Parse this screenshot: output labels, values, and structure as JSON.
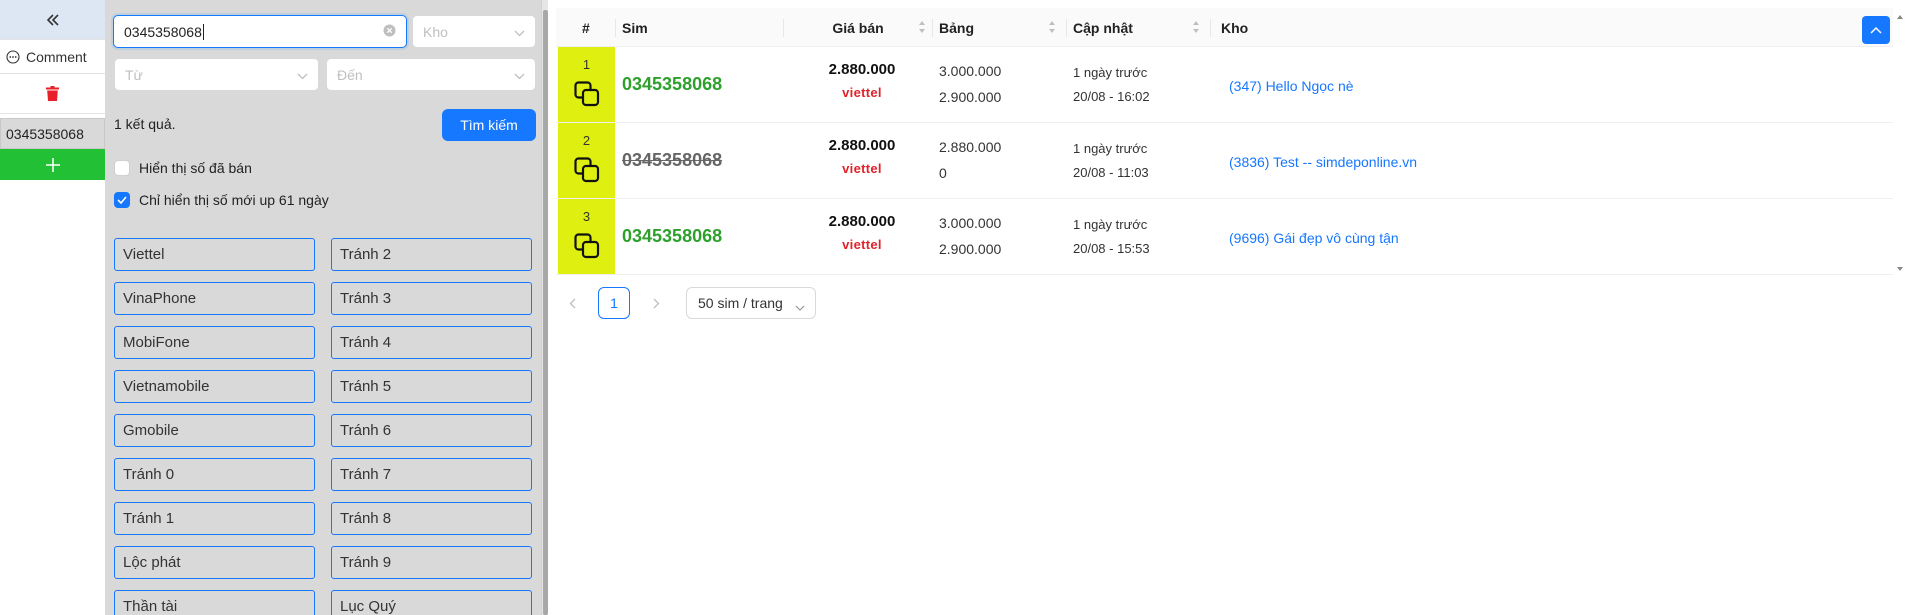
{
  "nav": {
    "collapse_icon": "double-chevron-left-icon",
    "comment_label": "Comment",
    "selected_number": "0345358068",
    "add_icon": "+"
  },
  "filter": {
    "search_value": "0345358068",
    "kho_placeholder": "Kho",
    "from_placeholder": "Từ",
    "to_placeholder": "Đến",
    "result_count_text": "1 kết quả.",
    "search_button": "Tìm kiếm",
    "show_sold_label": "Hiển thị số đã bán",
    "show_sold_checked": false,
    "show_recent_label": "Chỉ hiển thị số mới up 61 ngày",
    "show_recent_checked": true,
    "tags_left": [
      "Viettel",
      "VinaPhone",
      "MobiFone",
      "Vietnamobile",
      "Gmobile",
      "Tránh 0",
      "Tránh 1",
      "Lộc phát",
      "Thần tài"
    ],
    "tags_right": [
      "Tránh 2",
      "Tránh 3",
      "Tránh 4",
      "Tránh 5",
      "Tránh 6",
      "Tránh 7",
      "Tránh 8",
      "Tránh 9",
      "Lục Quý"
    ]
  },
  "table": {
    "headers": {
      "index": "#",
      "sim": "Sim",
      "price": "Giá bán",
      "bang": "Bảng",
      "updated": "Cập nhật",
      "kho": "Kho"
    },
    "rows": [
      {
        "index": "1",
        "sim": "0345358068",
        "sold": false,
        "price": "2.880.000",
        "carrier": "viettel",
        "bang1": "3.000.000",
        "bang2": "2.900.000",
        "updated_rel": "1 ngày trước",
        "updated_at": "20/08 - 16:02",
        "kho": "(347) Hello Ngọc nè"
      },
      {
        "index": "2",
        "sim": "0345358068",
        "sold": true,
        "price": "2.880.000",
        "carrier": "viettel",
        "bang1": "2.880.000",
        "bang2": "0",
        "updated_rel": "1 ngày trước",
        "updated_at": "20/08 - 11:03",
        "kho": "(3836) Test -- simdeponline.vn"
      },
      {
        "index": "3",
        "sim": "0345358068",
        "sold": false,
        "price": "2.880.000",
        "carrier": "viettel",
        "bang1": "3.000.000",
        "bang2": "2.900.000",
        "updated_rel": "1 ngày trước",
        "updated_at": "20/08 - 15:53",
        "kho": "(9696) Gái đẹp vô cùng tận"
      }
    ]
  },
  "pagination": {
    "current_page": "1",
    "page_size": "50 sim / trang"
  },
  "colors": {
    "accent": "#1677ff",
    "index_cell": "#dff010",
    "sim_green": "#2ea02c",
    "carrier_red": "#e0232b",
    "add_green": "#22c034",
    "delete_red": "#e8202a"
  }
}
